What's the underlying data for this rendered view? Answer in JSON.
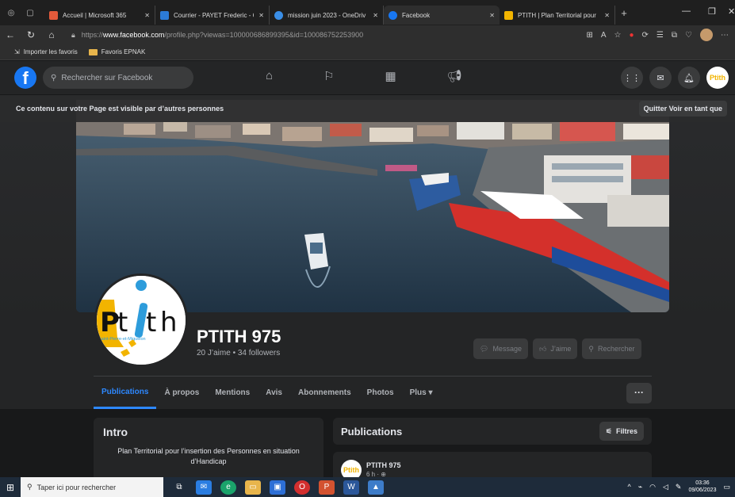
{
  "browser": {
    "tabs": [
      {
        "label": "Accueil | Microsoft 365",
        "icon": "m365-icon",
        "color": "#e35a3b"
      },
      {
        "label": "Courrier - PAYET Frederic - C",
        "icon": "outlook-icon",
        "color": "#2c7bd6"
      },
      {
        "label": "mission juin 2023 - OneDriv",
        "icon": "onedrive-icon",
        "color": "#3a8ee6"
      },
      {
        "label": "Facebook",
        "icon": "facebook-icon",
        "color": "#1877f2"
      },
      {
        "label": "PTITH | Plan Territorial pour",
        "icon": "ptith-icon",
        "color": "#f2b400"
      }
    ],
    "url_prefix": "https://",
    "url_host": "www.facebook.com",
    "url_path": "/profile.php?viewas=100000686899395&id=100086752253900",
    "bookmarks": [
      {
        "label": "Importer les favoris",
        "icon": "import-icon"
      },
      {
        "label": "Favoris EPNAK",
        "icon": "folder-icon"
      }
    ]
  },
  "facebook": {
    "search_placeholder": "Rechercher sur Facebook",
    "notice": "Ce contenu sur votre Page est visible par d’autres personnes",
    "notice_action": "Quitter Voir en tant que",
    "page": {
      "name": "PTITH 975",
      "stats": "20 J’aime • 34 followers",
      "avatar_text": "Ptith",
      "avatar_subtitle": "Saint-Pierre-et-Miquelon",
      "actions": [
        "Message",
        "J’aime",
        "Rechercher"
      ]
    },
    "tabs": [
      "Publications",
      "À propos",
      "Mentions",
      "Avis",
      "Abonnements",
      "Photos",
      "Plus ▾"
    ],
    "more_label": "···",
    "intro": {
      "title": "Intro",
      "description": "Plan Territorial pour l’insertion des Personnes en situation d’Handicap"
    },
    "publications": {
      "title": "Publications",
      "filter_label": "Filtres",
      "post_author": "PTITH 975",
      "post_time": "6 h · ⊕"
    }
  },
  "taskbar": {
    "search_placeholder": "Taper ici pour rechercher",
    "time": "03:36",
    "date": "09/06/2023"
  },
  "colors": {
    "facebook_blue": "#1877f2",
    "active_tab": "#2d88ff",
    "ptith_yellow": "#f2b400"
  }
}
